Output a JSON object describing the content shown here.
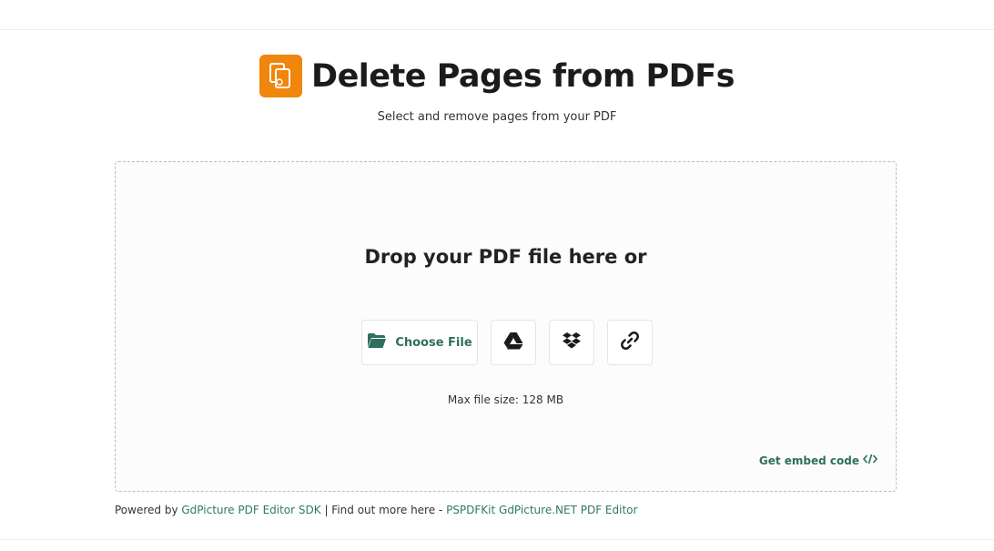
{
  "header": {
    "title": "Delete Pages from PDFs",
    "subtitle": "Select and remove pages from your PDF",
    "logo_icon": "pdf-pages-icon",
    "accent_color": "#f0860c"
  },
  "dropzone": {
    "prompt": "Drop your PDF file here or",
    "choose_file_label": "Choose File",
    "choose_file_icon": "folder-open-icon",
    "source_buttons": [
      {
        "icon": "google-drive-icon"
      },
      {
        "icon": "dropbox-icon"
      },
      {
        "icon": "link-icon"
      }
    ],
    "max_size_text": "Max file size: 128 MB",
    "embed_label": "Get embed code",
    "embed_icon": "code-icon"
  },
  "footer": {
    "powered_by_prefix": "Powered by ",
    "powered_by_link": "GdPicture PDF Editor SDK",
    "separator_text": " | Find out more here - ",
    "more_link": "PSPDFKit GdPicture.NET PDF Editor"
  }
}
